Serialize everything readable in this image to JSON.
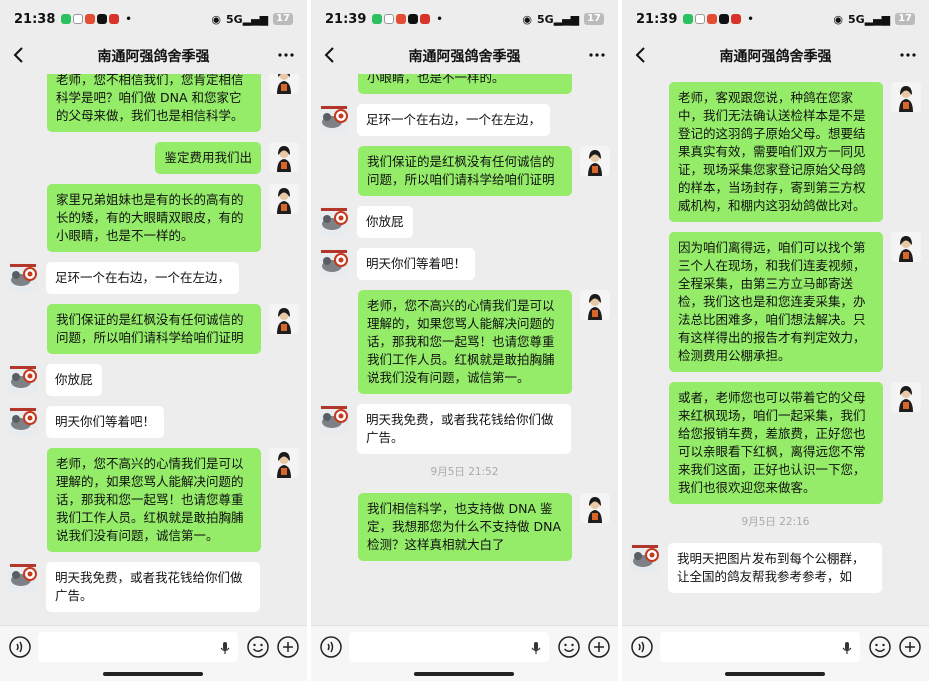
{
  "panels": [
    {
      "status_time": "21:38",
      "signal": "5G",
      "battery": "17",
      "title": "南通阿强鸽舍季强",
      "timestamp": "",
      "messages": [
        {
          "dir": "out",
          "text": "老师，您不相信我们，您肯定相信科学是吧？咱们做 DNA 和您家它的父母来做，我们也是相信科学。"
        },
        {
          "dir": "out",
          "text": "鉴定费用我们出"
        },
        {
          "dir": "out",
          "text": "家里兄弟姐妹也是有的长的高有的长的矮，有的大眼睛双眼皮，有的小眼睛，也是不一样的。"
        },
        {
          "dir": "in",
          "text": "足环一个在右边，一个在左边，"
        },
        {
          "dir": "out",
          "text": "我们保证的是红枫没有任何诚信的问题，所以咱们请科学给咱们证明"
        },
        {
          "dir": "in",
          "text": "你放屁"
        },
        {
          "dir": "in",
          "text": "明天你们等着吧！"
        },
        {
          "dir": "out",
          "text": "老师，您不高兴的心情我们是可以理解的，如果您骂人能解决问题的话，那我和您一起骂！也请您尊重我们工作人员。红枫就是敢拍胸脯说我们没有问题，诚信第一。"
        },
        {
          "dir": "in",
          "text": "明天我免费，或者我花钱给你们做广告。"
        }
      ]
    },
    {
      "status_time": "21:39",
      "signal": "5G",
      "battery": "17",
      "title": "南通阿强鸽舍季强",
      "timestamp": "9月5日 21:52",
      "messages": [
        {
          "dir": "out",
          "text": "家里兄弟姐妹也是有的长的高有的长的矮，有的大眼睛双眼皮，有的小眼睛，也是不一样的。"
        },
        {
          "dir": "in",
          "text": "足环一个在右边，一个在左边，"
        },
        {
          "dir": "out",
          "text": "我们保证的是红枫没有任何诚信的问题，所以咱们请科学给咱们证明"
        },
        {
          "dir": "in",
          "text": "你放屁"
        },
        {
          "dir": "in",
          "text": "明天你们等着吧！"
        },
        {
          "dir": "out",
          "text": "老师，您不高兴的心情我们是可以理解的，如果您骂人能解决问题的话，那我和您一起骂！也请您尊重我们工作人员。红枫就是敢拍胸脯说我们没有问题，诚信第一。"
        },
        {
          "dir": "in",
          "text": "明天我免费，或者我花钱给你们做广告。"
        },
        {
          "dir": "out",
          "text": "我们相信科学，也支持做 DNA 鉴定，我想那您为什么不支持做 DNA 检测？这样真相就大白了"
        }
      ]
    },
    {
      "status_time": "21:39",
      "signal": "5G",
      "battery": "17",
      "title": "南通阿强鸽舍季强",
      "timestamp": "9月5日 22:16",
      "messages": [
        {
          "dir": "out",
          "text": "老师，客观跟您说，种鸽在您家中，我们无法确认送检样本是不是登记的这羽鸽子原始父母。想要结果真实有效，需要咱们双方一同见证，现场采集您家登记原始父母鸽的样本，当场封存，寄到第三方权威机构，和棚内这羽幼鸽做比对。"
        },
        {
          "dir": "out",
          "text": "因为咱们离得远，咱们可以找个第三个人在现场，和我们连麦视频，全程采集，由第三方立马邮寄送检，我们这也是和您连麦采集，办法总比困难多，咱们想法解决。只有这样得出的报告才有判定效力，检测费用公棚承担。"
        },
        {
          "dir": "out",
          "text": "或者，老师您也可以带着它的父母来红枫现场，咱们一起采集，我们给您报销车费，差旅费，正好您也可以亲眼看下红枫，离得远您不常来我们这面，正好也认识一下您，我们也很欢迎您来做客。"
        },
        {
          "dir": "in",
          "text": "我明天把图片发布到每个公棚群，让全国的鸽友帮我参考参考，如"
        }
      ]
    }
  ],
  "colors": {
    "outgoing_bubble": "#95ec69",
    "incoming_bubble": "#ffffff",
    "background": "#ededed"
  },
  "icons": {
    "back": "chevron-left-icon",
    "more": "more-icon",
    "voice": "voice-icon",
    "emoji": "emoji-icon",
    "plus": "plus-icon",
    "mic": "mic-icon"
  }
}
